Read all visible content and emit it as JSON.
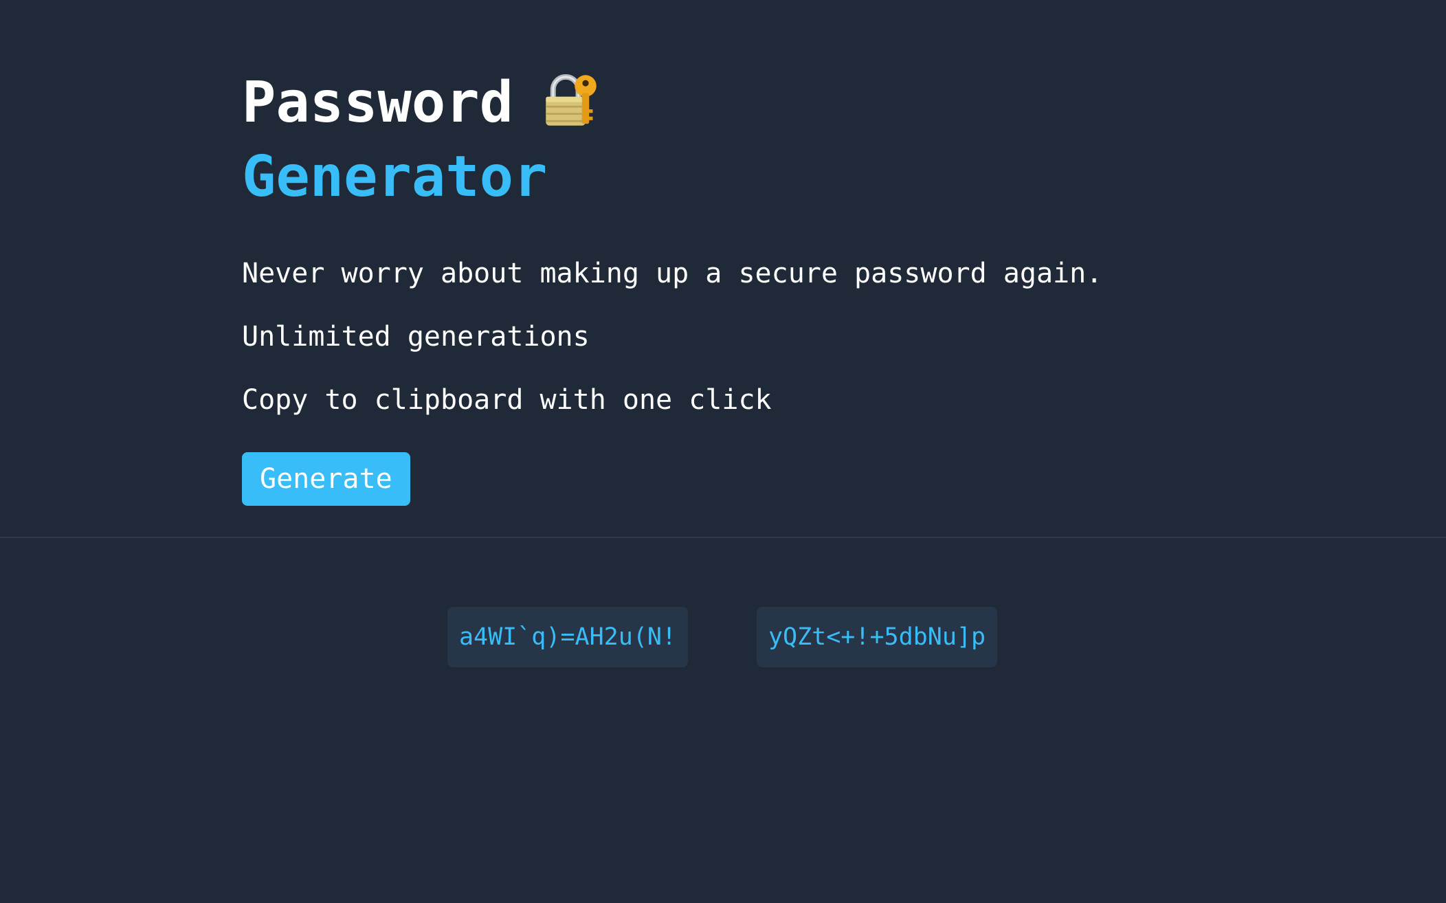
{
  "header": {
    "title_line1": "Password",
    "title_icon": "lock-with-key-icon",
    "title_line2": "Generator"
  },
  "tagline": "Never worry about making up a secure password again.",
  "features": [
    "Unlimited generations",
    "Copy to clipboard with one click"
  ],
  "generate_button": {
    "label": "Generate"
  },
  "passwords": [
    "a4WI`q)=AH2u(N!",
    "yQZt<+!+5dbNu]p"
  ],
  "colors": {
    "background": "#1f2937",
    "accent": "#38bdf8",
    "password_box": "#273549",
    "text": "#ffffff"
  }
}
